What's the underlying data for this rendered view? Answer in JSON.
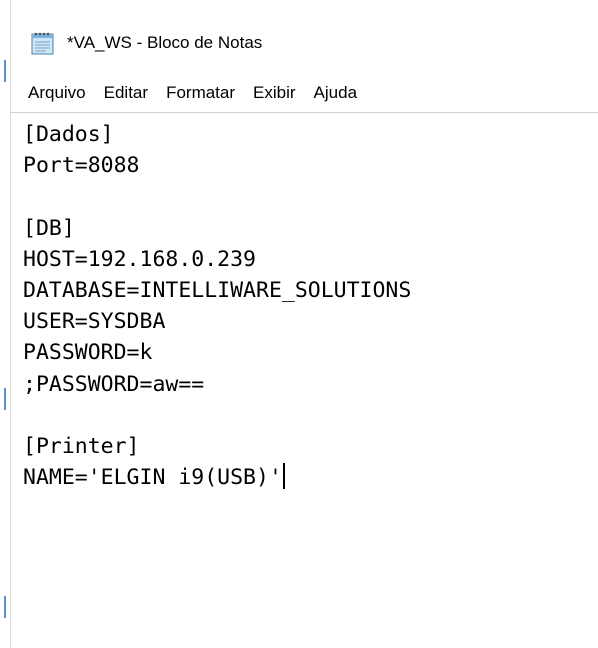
{
  "window": {
    "title": "*VA_WS - Bloco de Notas",
    "icon": "notepad-icon"
  },
  "menu": {
    "items": [
      {
        "label": "Arquivo"
      },
      {
        "label": "Editar"
      },
      {
        "label": "Formatar"
      },
      {
        "label": "Exibir"
      },
      {
        "label": "Ajuda"
      }
    ]
  },
  "editor": {
    "lines": [
      "[Dados]",
      "Port=8088",
      "",
      "[DB]",
      "HOST=192.168.0.239",
      "DATABASE=INTELLIWARE_SOLUTIONS",
      "USER=SYSDBA",
      "PASSWORD=k",
      ";PASSWORD=aw==",
      "",
      "[Printer]",
      "NAME='ELGIN i9(USB)'"
    ],
    "caret_line": 11
  },
  "colors": {
    "background": "#ffffff",
    "text": "#000000",
    "accent": "#5b8fc7"
  }
}
